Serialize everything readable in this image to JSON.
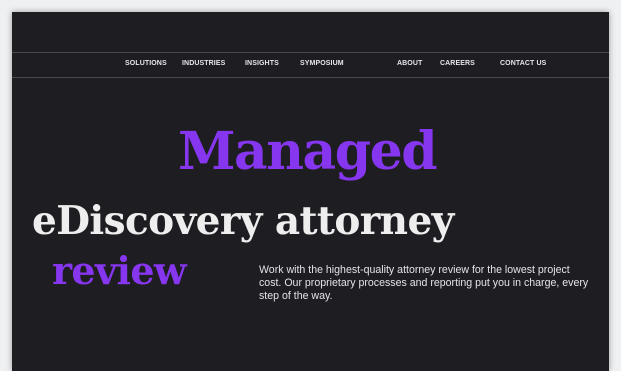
{
  "nav": {
    "items": [
      {
        "label": "SOLUTIONS"
      },
      {
        "label": "INDUSTRIES"
      },
      {
        "label": "INSIGHTS"
      },
      {
        "label": "SYMPOSIUM"
      },
      {
        "label": "ABOUT"
      },
      {
        "label": "CAREERS"
      },
      {
        "label": "CONTACT US"
      }
    ]
  },
  "hero": {
    "line1": "Managed",
    "line2": "eDiscovery attorney",
    "line3": "review",
    "intro": "Work with the highest-quality attorney review for the lowest project cost. Our proprietary processes and reporting put you in charge, every step of the way."
  },
  "colors": {
    "background": "#1e1d22",
    "accent": "#8736f0",
    "heading": "#eeeeee",
    "nav_text": "#e6e6ea"
  }
}
